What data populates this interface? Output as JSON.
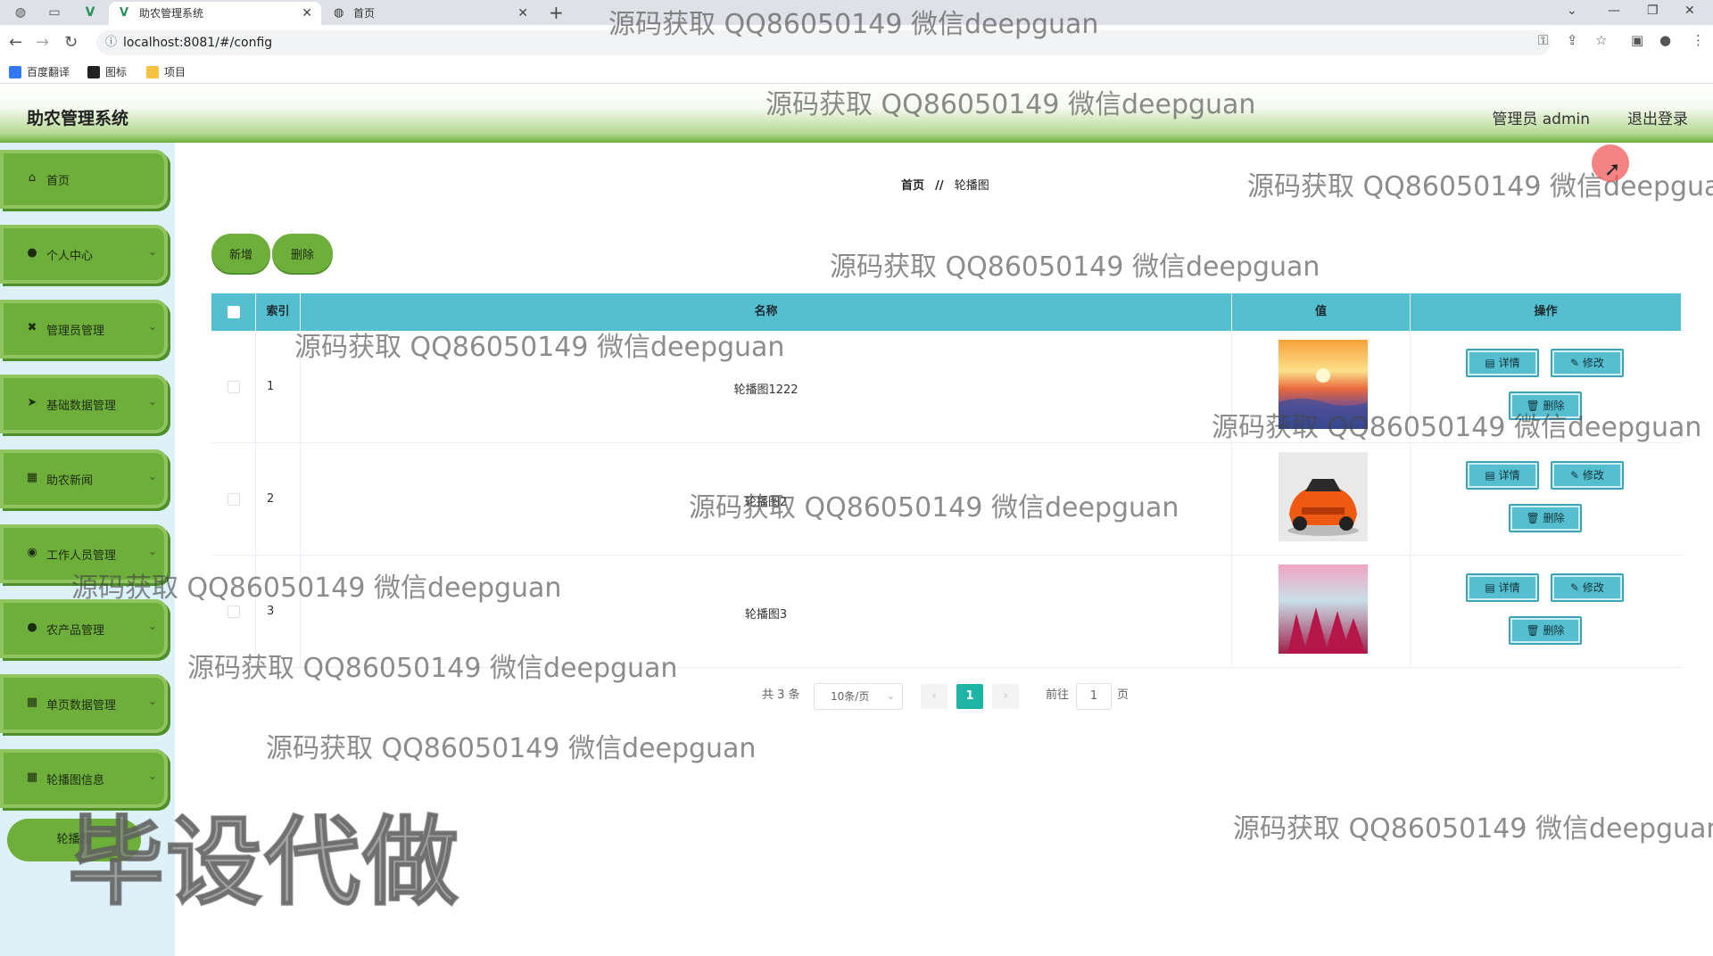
{
  "browser": {
    "tabs": [
      {
        "title": "助农管理系统",
        "active": true
      },
      {
        "title": "首页",
        "active": false
      }
    ],
    "url": "localhost:8081/#/config",
    "bookmarks": [
      "百度翻译",
      "图标",
      "项目"
    ]
  },
  "header": {
    "title": "助农管理系统",
    "admin": "管理员 admin",
    "logout": "退出登录"
  },
  "sidebar": {
    "items": [
      {
        "label": "首页",
        "icon": "home-icon"
      },
      {
        "label": "个人中心",
        "icon": "person-icon"
      },
      {
        "label": "管理员管理",
        "icon": "admin-icon"
      },
      {
        "label": "基础数据管理",
        "icon": "send-icon"
      },
      {
        "label": "助农新闻",
        "icon": "grid-icon"
      },
      {
        "label": "工作人员管理",
        "icon": "pin-icon"
      },
      {
        "label": "农产品管理",
        "icon": "person-icon"
      },
      {
        "label": "单页数据管理",
        "icon": "grid-icon"
      },
      {
        "label": "轮播图信息",
        "icon": "grid-icon"
      }
    ],
    "sub_item": "轮播图"
  },
  "breadcrumb": {
    "home": "首页",
    "sep": "//",
    "current": "轮播图"
  },
  "toolbar": {
    "add": "新增",
    "delete": "删除"
  },
  "table": {
    "columns": [
      "索引",
      "名称",
      "值",
      "操作"
    ],
    "rows": [
      {
        "index": "1",
        "name": "轮播图1222",
        "image": "sunset-sea"
      },
      {
        "index": "2",
        "name": "轮播图2",
        "image": "orange-sports-car"
      },
      {
        "index": "3",
        "name": "轮播图3",
        "image": "pink-flowers"
      }
    ],
    "actions": {
      "detail": "详情",
      "edit": "修改",
      "delete": "删除"
    }
  },
  "pagination": {
    "total": "共 3 条",
    "page_size": "10条/页",
    "current_page": "1",
    "goto_label": "前往",
    "goto_value": "1",
    "page_unit": "页"
  },
  "watermark": {
    "text": "源码获取 QQ86050149 微信deepguan",
    "big": "毕设代做"
  },
  "colors": {
    "accent_green": "#6eae3a",
    "table_header": "#55bfcf",
    "pager_active": "#1fb5a4"
  }
}
